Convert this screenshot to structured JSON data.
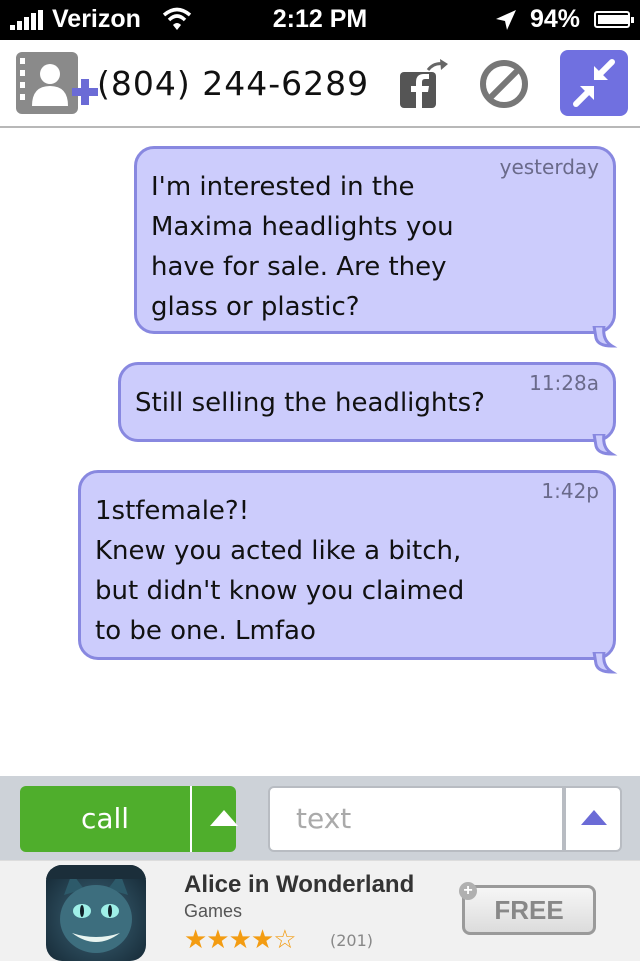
{
  "status_bar": {
    "carrier": "Verizon",
    "time": "2:12 PM",
    "battery": "94%",
    "battery_level": 0.94
  },
  "header": {
    "phone_number": "(804) 244-6289",
    "icons": [
      "add-contact-icon",
      "facebook-share-icon",
      "block-icon",
      "collapse-icon"
    ]
  },
  "messages": [
    {
      "timestamp": "yesterday",
      "text": "I'm interested in the\nMaxima headlights you\nhave for sale. Are they\nglass or plastic?"
    },
    {
      "timestamp": "11:28a",
      "text": "Still selling the headlights?"
    },
    {
      "timestamp": "1:42p",
      "text": "1stfemale?!\nKnew you acted like a bitch,\nbut didn't know you claimed\nto be one. Lmfao"
    }
  ],
  "input_bar": {
    "call_label": "call",
    "text_placeholder": "text"
  },
  "ad": {
    "title": "Alice in Wonderland",
    "category": "Games",
    "stars": "★★★★☆",
    "rating": 4.5,
    "rating_count": "(201)",
    "button_label": "FREE"
  },
  "colors": {
    "bubble_fill": "#ccccfc",
    "bubble_border": "#8888e0",
    "call_green": "#4fae2c",
    "accent_purple": "#7070e0"
  }
}
